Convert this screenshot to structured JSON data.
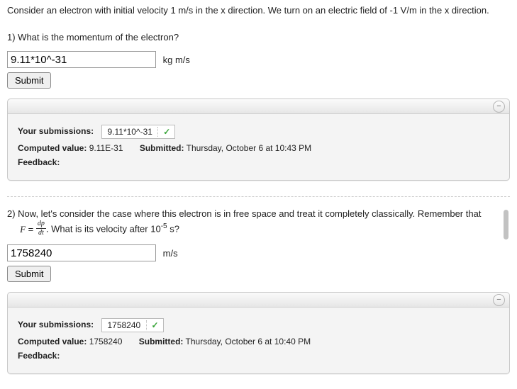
{
  "intro": "Consider an electron with initial velocity 1 m/s in the x direction. We turn on an electric field of -1 V/m in the x direction.",
  "q1": {
    "prompt": "1) What is the momentum of the electron?",
    "input_value": "9.11*10^-31",
    "unit": "kg m/s",
    "submit_label": "Submit",
    "submissions_label": "Your submissions:",
    "submission_value": "9.11*10^-31",
    "computed_label": "Computed value:",
    "computed_value": "9.11E-31",
    "submitted_label": "Submitted:",
    "submitted_value": "Thursday, October 6 at 10:43 PM",
    "feedback_label": "Feedback:"
  },
  "q2": {
    "prompt_a": "2) Now, let's consider the case where this electron is in free space and treat it completely classically. Remember that",
    "formula_lhs": "F",
    "formula_eq": "=",
    "frac_num": "dp",
    "frac_den": "dt",
    "prompt_b": ". What is its velocity after 10",
    "exp": "-5",
    "prompt_c": " s?",
    "input_value": "1758240",
    "unit": "m/s",
    "submit_label": "Submit",
    "submissions_label": "Your submissions:",
    "submission_value": "1758240",
    "computed_label": "Computed value:",
    "computed_value": "1758240",
    "submitted_label": "Submitted:",
    "submitted_value": "Thursday, October 6 at 10:40 PM",
    "feedback_label": "Feedback:"
  },
  "collapse_glyph": "−"
}
